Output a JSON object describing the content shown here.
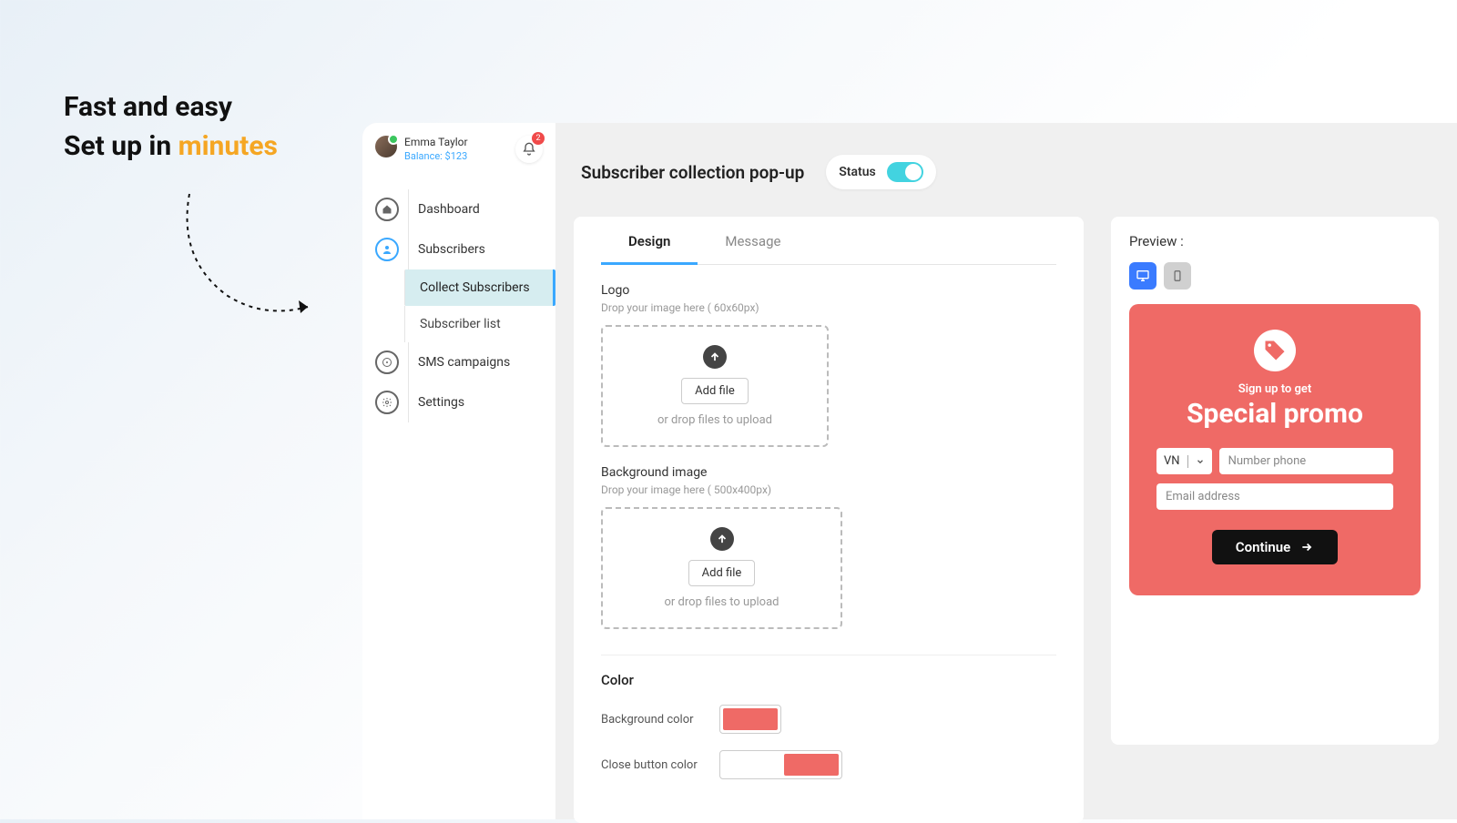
{
  "hero": {
    "line1": "Fast and easy",
    "line2_prefix": "Set up in ",
    "line2_highlight": "minutes"
  },
  "profile": {
    "name": "Emma Taylor",
    "balance": "Balance: $123",
    "notification_count": "2"
  },
  "nav": {
    "dashboard": "Dashboard",
    "subscribers": "Subscribers",
    "collect_subscribers": "Collect Subscribers",
    "subscriber_list": "Subscriber list",
    "sms_campaigns": "SMS campaigns",
    "settings": "Settings"
  },
  "page": {
    "title": "Subscriber collection pop-up",
    "status_label": "Status"
  },
  "tabs": {
    "design": "Design",
    "message": "Message"
  },
  "logo_section": {
    "label": "Logo",
    "hint": "Drop your image here ( 60x60px)",
    "add_file": "Add file",
    "drop_hint": "or drop files to upload"
  },
  "bg_section": {
    "label": "Background image",
    "hint": "Drop your image here ( 500x400px)",
    "add_file": "Add file",
    "drop_hint": "or drop files to upload"
  },
  "color_section": {
    "title": "Color",
    "bg_label": "Background color",
    "close_label": "Close button color",
    "bg_value": "#ef6a66",
    "close_value": "#ef6a66"
  },
  "preview": {
    "label": "Preview :",
    "promo_sub": "Sign up to get",
    "promo_title": "Special promo",
    "country": "VN",
    "phone_placeholder": "Number phone",
    "email_placeholder": "Email address",
    "continue": "Continue"
  }
}
